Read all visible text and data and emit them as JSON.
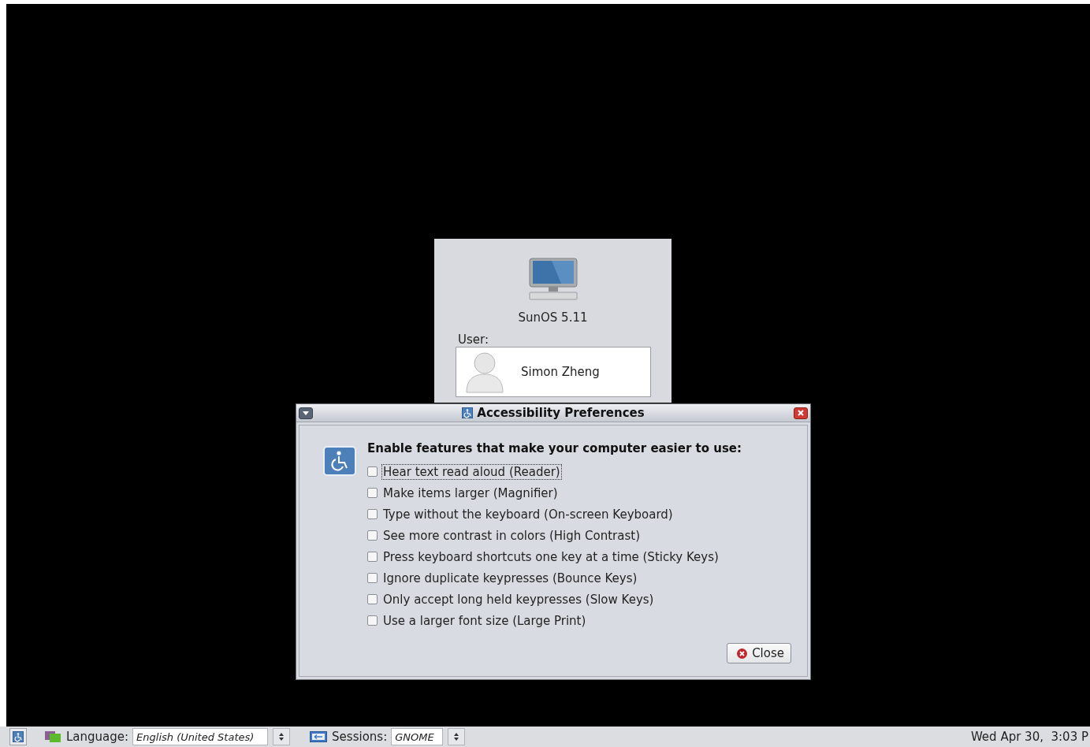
{
  "login": {
    "host": "SunOS 5.11",
    "user_label": "User:",
    "user_name": "Simon Zheng"
  },
  "dialog": {
    "title": "Accessibility Preferences",
    "heading": "Enable features that make your computer easier to use:",
    "options": [
      {
        "label": "Hear text read aloud (Reader)",
        "checked": false,
        "focused": true
      },
      {
        "label": "Make items larger (Magnifier)",
        "checked": false,
        "focused": false
      },
      {
        "label": "Type without the keyboard (On-screen Keyboard)",
        "checked": false,
        "focused": false
      },
      {
        "label": "See more contrast in colors (High Contrast)",
        "checked": false,
        "focused": false
      },
      {
        "label": "Press keyboard shortcuts one key at a time (Sticky Keys)",
        "checked": false,
        "focused": false
      },
      {
        "label": "Ignore duplicate keypresses (Bounce Keys)",
        "checked": false,
        "focused": false
      },
      {
        "label": "Only accept long held keypresses (Slow Keys)",
        "checked": false,
        "focused": false
      },
      {
        "label": "Use a larger font size (Large Print)",
        "checked": false,
        "focused": false
      }
    ],
    "close_button": "Close"
  },
  "taskbar": {
    "language_label": "Language:",
    "language_value": "English (United States)",
    "sessions_label": "Sessions:",
    "sessions_value": "GNOME",
    "clock": "Wed Apr 30,  3:03 P"
  }
}
